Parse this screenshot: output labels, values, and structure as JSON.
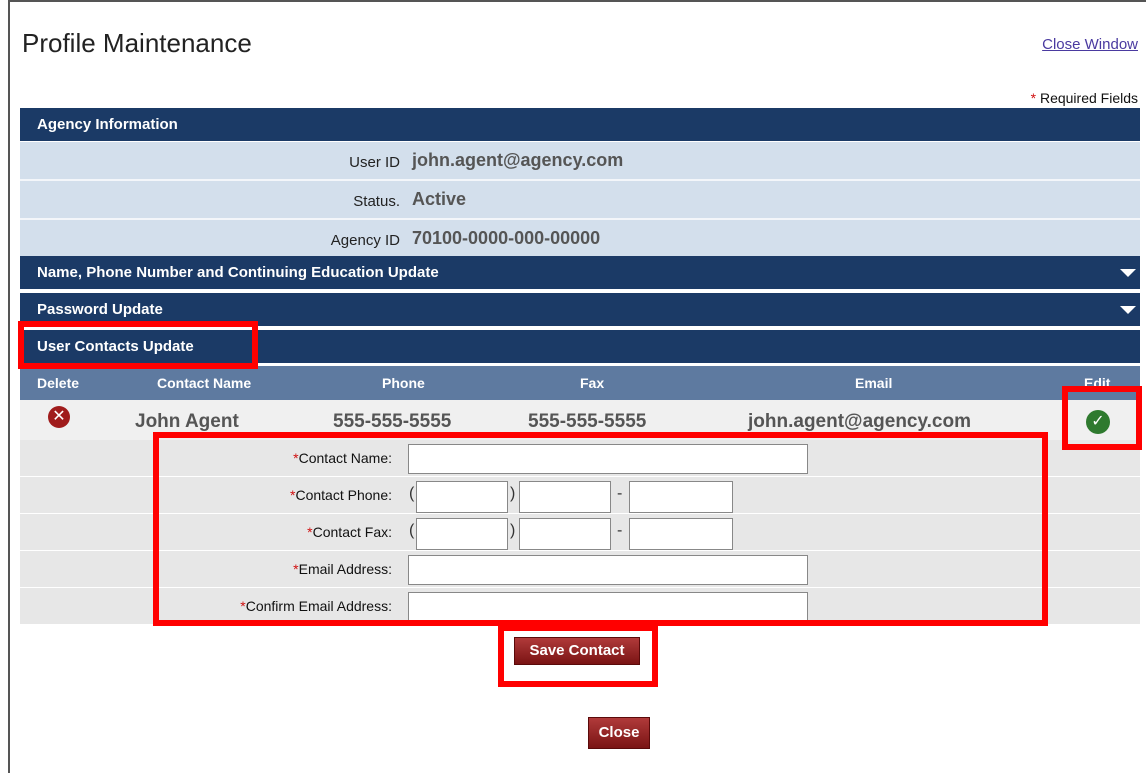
{
  "header": {
    "title": "Profile Maintenance",
    "close_window": "Close Window",
    "required_star": "*",
    "required_text": " Required Fields"
  },
  "agency": {
    "section_title": "Agency Information",
    "user_id_label": "User ID",
    "user_id_value": "john.agent@agency.com",
    "status_label": "Status.",
    "status_value": "Active",
    "agency_id_label": "Agency ID",
    "agency_id_value": "70100-0000-000-00000"
  },
  "sections": {
    "name_phone": "Name, Phone Number and Continuing Education Update",
    "password": "Password Update",
    "user_contacts": "User Contacts Update"
  },
  "table": {
    "columns": [
      "Delete",
      "Contact Name",
      "Phone",
      "Fax",
      "Email",
      "Edit"
    ],
    "row": {
      "contact_name": "John Agent",
      "phone": "555-555-5555",
      "fax": "555-555-5555",
      "email": "john.agent@agency.com"
    }
  },
  "form": {
    "required_star": "*",
    "contact_name_label": "Contact Name:",
    "contact_phone_label": "Contact Phone:",
    "contact_fax_label": "Contact Fax:",
    "email_label": "Email Address:",
    "confirm_email_label": "Confirm Email Address:",
    "paren_open": "(",
    "paren_close": ")",
    "dash": "-"
  },
  "buttons": {
    "save_contact": "Save Contact",
    "close": "Close"
  },
  "icons": {
    "delete": "delete-icon",
    "edit": "check-icon",
    "expand": "chevron-down-icon"
  },
  "colors": {
    "header_bg": "#1b3a66",
    "column_header_bg": "#5e7aa0",
    "info_row_bg": "#d3dfec",
    "highlight": "#ff0000",
    "button": "#8e2020"
  }
}
